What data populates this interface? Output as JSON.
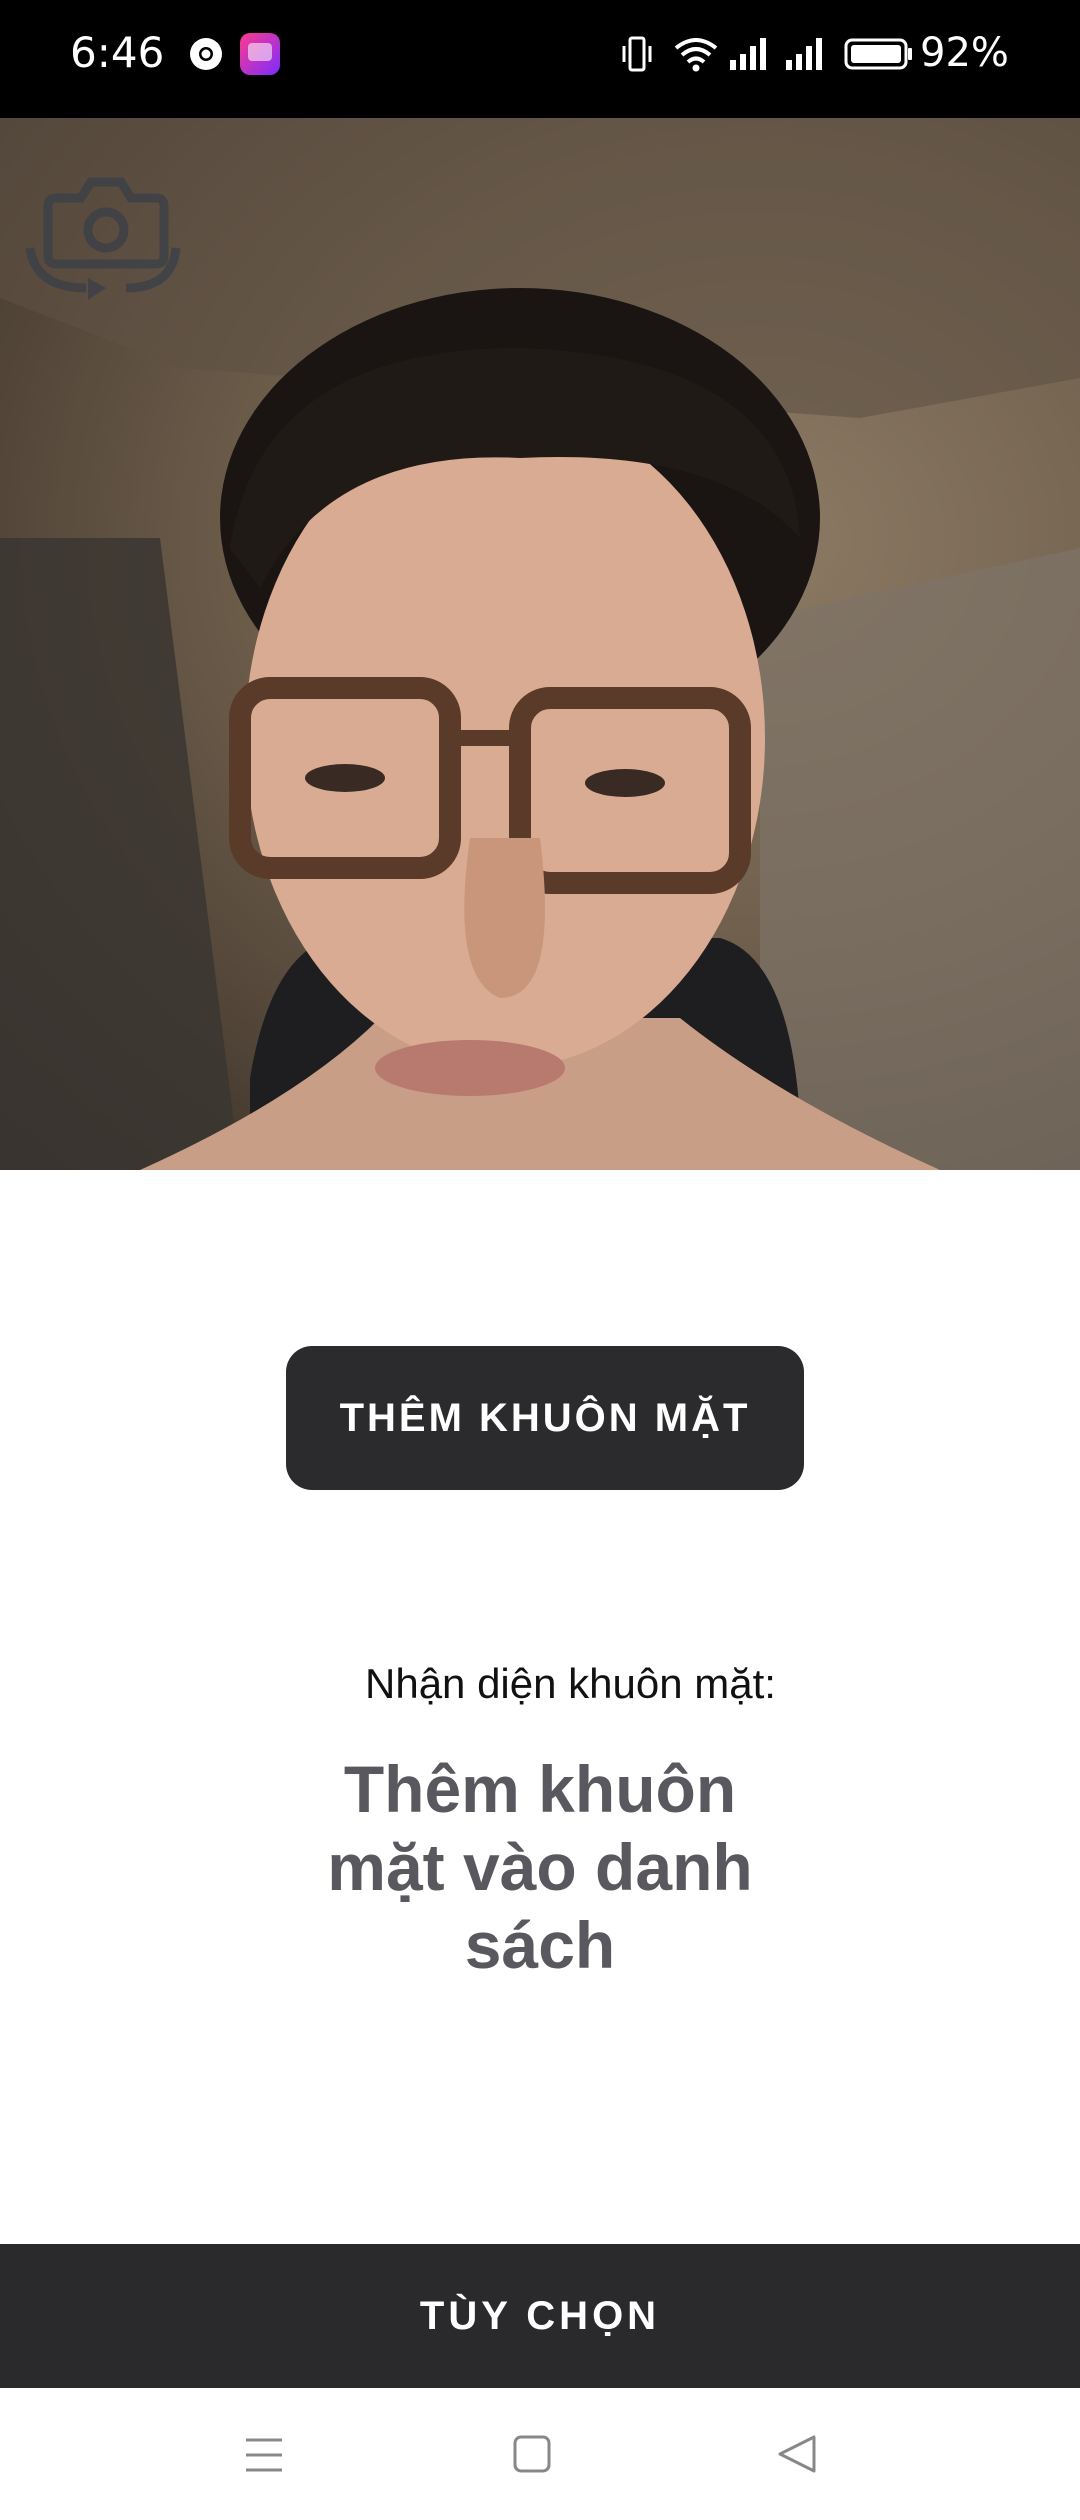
{
  "status_bar": {
    "time": "6:46",
    "battery": "92%",
    "icons": [
      "chrome-icon",
      "app-notification-icon",
      "vibrate-icon",
      "wifi-icon",
      "signal-icon",
      "signal-icon",
      "battery-icon"
    ]
  },
  "camera": {
    "switch_icon": "camera-switch-icon"
  },
  "main": {
    "add_face_label": "THÊM KHUÔN MẶT",
    "recognition_label": "Nhận diện khuôn mặt:",
    "recognition_value": "Thêm khuôn mặt vào danh sách"
  },
  "bottom": {
    "options_label": "TÙY CHỌN"
  },
  "nav": {
    "icons": [
      "menu-icon",
      "home-icon",
      "back-icon"
    ]
  },
  "colors": {
    "dark_button": "#2b2b2e",
    "recognition_text": "#58585e",
    "status_bar_bg": "#000000"
  }
}
